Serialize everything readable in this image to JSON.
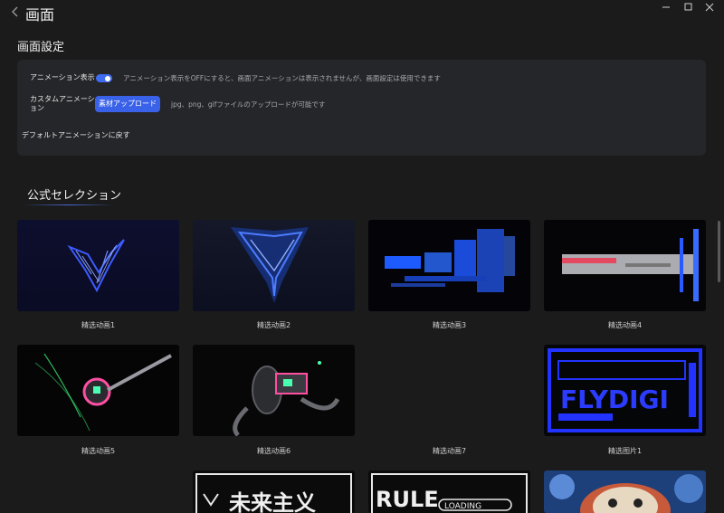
{
  "window": {
    "title": "画面",
    "back_icon": "chevron-left-icon",
    "controls": [
      "minimize-icon",
      "maximize-icon",
      "close-icon"
    ]
  },
  "settings": {
    "section_title": "画面設定",
    "animation_display": {
      "label": "アニメーション表示",
      "enabled": true,
      "hint": "アニメーション表示をOFFにすると、画面アニメーションは表示されませんが、画面設定は使用できます"
    },
    "custom_animation": {
      "label_line1": "カスタムアニメーシ",
      "label_line2": "ョン",
      "button": "素材アップロード",
      "hint": "jpg、png、gifファイルのアップロードが可能です"
    },
    "reset_link": "デフォルトアニメーションに戻す"
  },
  "gallery": {
    "title": "公式セレクション",
    "items": [
      {
        "caption": "精选动画1"
      },
      {
        "caption": "精选动画2"
      },
      {
        "caption": "精选动画3"
      },
      {
        "caption": "精选动画4"
      },
      {
        "caption": "精选动画5"
      },
      {
        "caption": "精选动画6"
      },
      {
        "caption": "精选动画7"
      },
      {
        "caption": "精选图片1",
        "logo_text": "FLYDIGI"
      },
      {
        "caption": "",
        "logo_text": "未来主义"
      },
      {
        "caption": "",
        "logo_text": "RULE",
        "sub_text": "LOADING"
      },
      {
        "caption": ""
      }
    ]
  },
  "colors": {
    "background": "#1b1b1c",
    "panel": "#252629",
    "accent": "#3a62e8"
  }
}
